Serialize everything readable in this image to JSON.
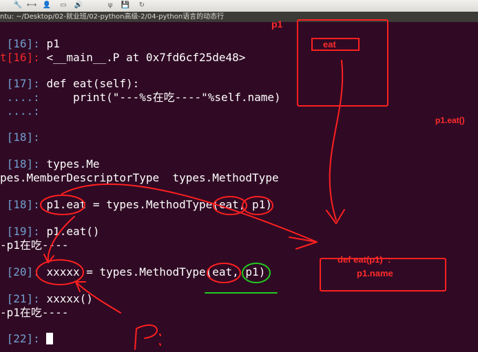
{
  "toolbar": {
    "icons": [
      "wrench-icon",
      "link-icon",
      "user-icon",
      "drive-icon",
      "volume-icon",
      "usb-icon",
      "save-icon",
      "refresh-icon"
    ],
    "glyphs": [
      "🔧",
      "⟷",
      "👤",
      "▭",
      "🔊",
      "ψ",
      "💾",
      "↻"
    ]
  },
  "window": {
    "title": "ntu: ~/Desktop/02-就业班/02-python高级-2/04-python语言的动态行"
  },
  "terminal": {
    "lines": [
      {
        "prompt": " [16]: ",
        "text": "p1"
      },
      {
        "prompt": "t[16]: ",
        "text": "<__main__.P at 0x7fd6cf25de48>"
      },
      {
        "prompt": " [17]: ",
        "text": "def eat(self):"
      },
      {
        "prompt": " ....: ",
        "text": "    print(\"---%s在吃----\"%self.name)"
      },
      {
        "prompt": " ....: ",
        "text": ""
      },
      {
        "prompt": " [18]: ",
        "text": ""
      },
      {
        "prompt": " [18]: ",
        "text": "types.Me"
      },
      {
        "prompt": "",
        "text": "pes.MemberDescriptorType  types.MethodType"
      },
      {
        "prompt": " [18]: ",
        "text": "p1.eat = types.MethodType(eat, p1)"
      },
      {
        "prompt": " [19]: ",
        "text": "p1.eat()"
      },
      {
        "prompt": "",
        "text": "-p1在吃----"
      },
      {
        "prompt": " [20]: ",
        "text": "xxxxx = types.MethodType(eat, p1)"
      },
      {
        "prompt": " [21]: ",
        "text": "xxxxx()"
      },
      {
        "prompt": "",
        "text": "-p1在吃----"
      },
      {
        "prompt": " [22]: ",
        "text": ""
      }
    ]
  },
  "annotations": {
    "p1_label": "p1",
    "eat_label": "eat",
    "p1_eat_label": "p1.eat()",
    "def_label": "def eat(p1)  :",
    "name_label": "p1.name"
  }
}
